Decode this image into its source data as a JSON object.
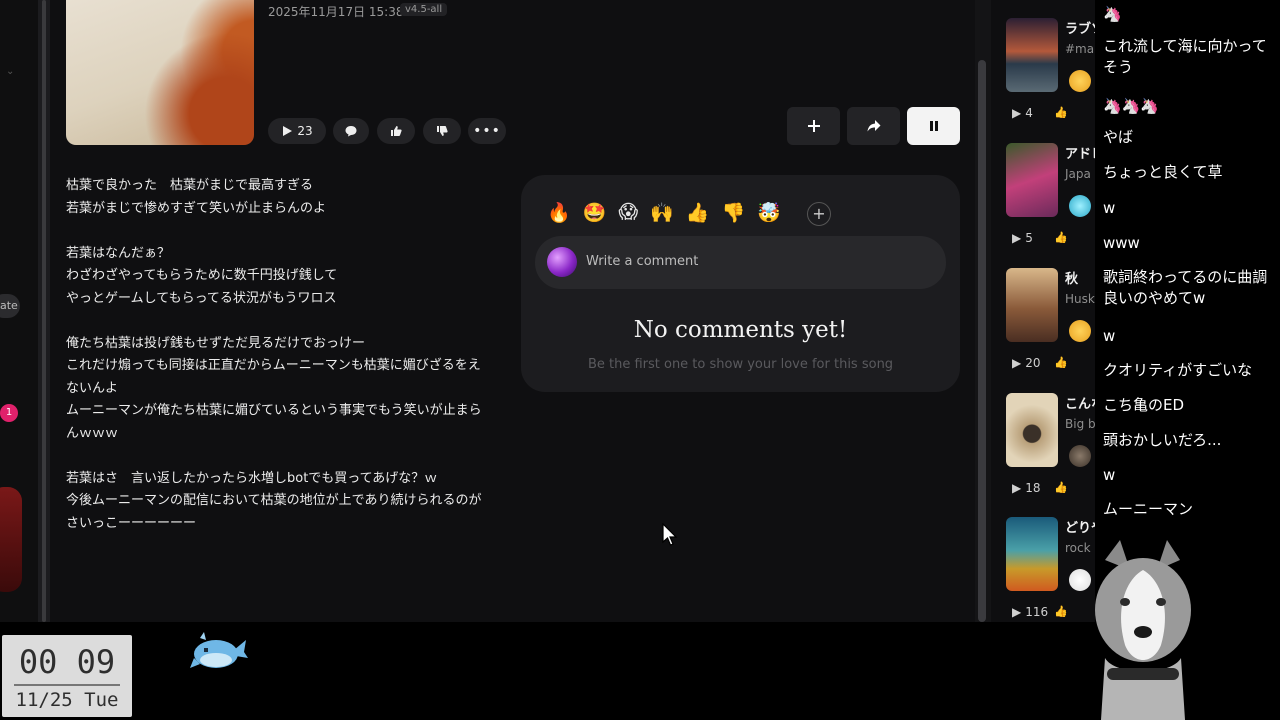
{
  "song": {
    "date": "2025年11月17日 15:38",
    "version": "v4.5-all",
    "play_count": "23"
  },
  "lyrics": "枯葉で良かった　枯葉がまじで最高すぎる\n若葉がまじで惨めすぎて笑いが止まらんのよ\n\n若葉はなんだぁ？\nわざわざやってもらうために数千円投げ銭して\nやっとゲームしてもらってる状況がもうワロス\n\n俺たち枯葉は投げ銭もせずただ見るだけでおっけー\nこれだけ煽っても同接は正直だからムーニーマンも枯葉に媚びざるをえないんよ\nムーニーマンが俺たち枯葉に媚びているという事実でもう笑いが止まらんｗｗｗ\n\n若葉はさ　言い返したかったら水増しbotでも買ってあげな？ｗ\n今後ムーニーマンの配信において枯葉の地位が上であり続けられるのがさいっこーーーーーー",
  "left_strip": {
    "rate_label": "ate",
    "notification_count": "1"
  },
  "comments": {
    "reactions": [
      "🔥",
      "🤩",
      "😱",
      "🙌",
      "👍",
      "👎",
      "🤯"
    ],
    "add_reaction": "+",
    "input_placeholder": "Write a comment",
    "empty_title": "No comments yet!",
    "empty_subtitle": "Be the first one to show your love for this song"
  },
  "playlist": [
    {
      "title": "ラブソ",
      "subtitle": "#mal",
      "count": "4",
      "thumb": "sunset-sea"
    },
    {
      "title": "アドレ",
      "subtitle": "Japa",
      "count": "5",
      "thumb": "pink-guitar"
    },
    {
      "title": "秋",
      "subtitle": "Husk",
      "count": "20",
      "thumb": "old-building"
    },
    {
      "title": "こんな",
      "subtitle": "Big b",
      "count": "18",
      "thumb": "radio"
    },
    {
      "title": "どりや",
      "subtitle": "rock",
      "count": "116",
      "thumb": "flower-field"
    }
  ],
  "chat": [
    {
      "text": "🦄"
    },
    {
      "text": "これ流して海に向かってそう"
    },
    {
      "text": "🦄🦄🦄"
    },
    {
      "text": "やば"
    },
    {
      "text": "ちょっと良くて草"
    },
    {
      "text": "w"
    },
    {
      "text": "www"
    },
    {
      "text": "歌詞終わってるのに曲調良いのやめてw"
    },
    {
      "text": "w"
    },
    {
      "text": "クオリティがすごいな"
    },
    {
      "text": "こち亀のED"
    },
    {
      "text": "頭おかしいだろ..."
    },
    {
      "text": "w"
    },
    {
      "text": "ムーニーマン"
    }
  ],
  "clock": {
    "time": "00 09",
    "date": "11/25 Tue"
  },
  "colors": {
    "accent_pink": "#e0216b",
    "panel": "#1c1c1f",
    "background": "#0f0f11"
  }
}
